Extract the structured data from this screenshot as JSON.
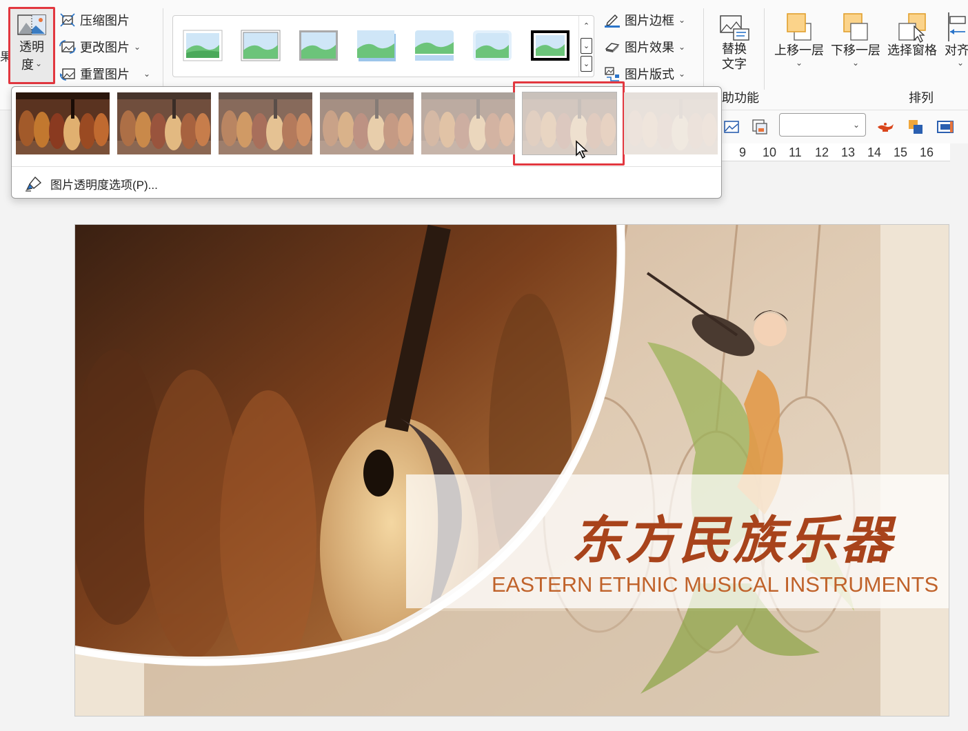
{
  "ribbon": {
    "edge_cut_label": "果",
    "transparency": {
      "label_line1": "透明",
      "label_line2": "度",
      "caret": "⌄"
    },
    "adjust": {
      "compress": "压缩图片",
      "change": "更改图片",
      "reset": "重置图片",
      "caret": "⌄"
    },
    "styles_gallery": {
      "scroll_up": "⌃",
      "scroll_down": "⌄",
      "more": "⌄"
    },
    "picture_tools": {
      "border": "图片边框",
      "effects": "图片效果",
      "layout": "图片版式",
      "caret": "⌄"
    },
    "accessibility": {
      "alt_text_line1": "替换",
      "alt_text_line2": "文字",
      "group_label": "助功能"
    },
    "arrange": {
      "bring_forward": "上移一层",
      "send_backward": "下移一层",
      "selection_pane": "选择窗格",
      "align": "对齐",
      "caret": "⌄",
      "group_label": "排列"
    }
  },
  "transparency_menu": {
    "presets": [
      "0%",
      "15%",
      "30%",
      "50%",
      "65%",
      "80%",
      "95%"
    ],
    "selected_index": 5,
    "options_label": "图片透明度选项(P)..."
  },
  "toolbar2": {
    "font_value": "",
    "caret": "⌄"
  },
  "ruler": {
    "numbers": [
      "9",
      "10",
      "11",
      "12",
      "13",
      "14",
      "15",
      "16"
    ]
  },
  "slide": {
    "title_cn": "东方民族乐器",
    "title_en": "EASTERN ETHNIC MUSICAL INSTRUMENTS"
  },
  "colors": {
    "accent_red": "#e2373f",
    "title_brown": "#a8431b",
    "subtitle_orange": "#c0622a",
    "slide_bg": "#efe4d4"
  }
}
